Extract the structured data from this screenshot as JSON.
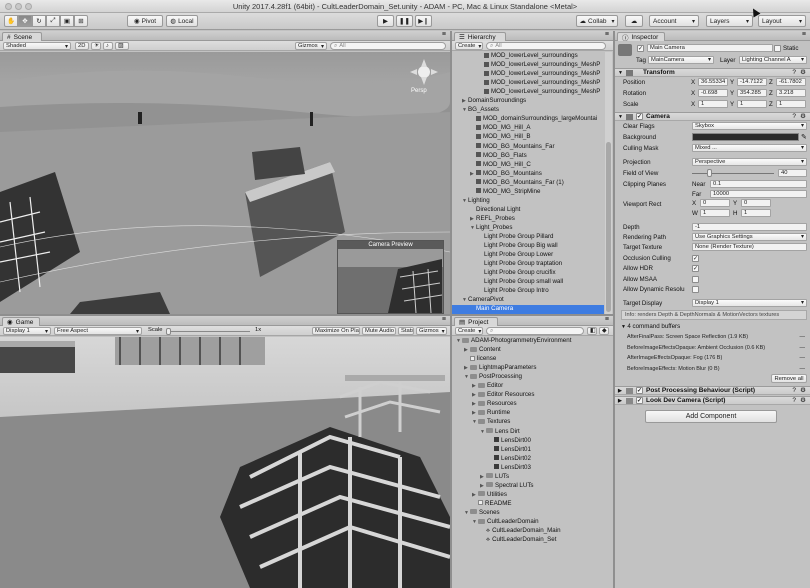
{
  "window": {
    "title": "Unity 2017.4.28f1 (64bit) - CultLeaderDomain_Set.unity - ADAM - PC, Mac & Linux Standalone <Metal>"
  },
  "toolbar": {
    "pivot": "Pivot",
    "local": "Local",
    "collab": "Collab",
    "account": "Account",
    "layers": "Layers",
    "layout": "Layout"
  },
  "scene": {
    "tab": "Scene",
    "shading": "Shaded",
    "mode_2d": "2D",
    "gizmos": "Gizmos",
    "search": "All",
    "persp": "Persp",
    "camera_preview": "Camera Preview"
  },
  "game": {
    "tab": "Game",
    "display": "Display 1",
    "aspect": "Free Aspect",
    "scale_label": "Scale",
    "scale_value": "1x",
    "maximize": "Maximize On Play",
    "mute": "Mute Audio",
    "stats": "Stats",
    "gizmos": "Gizmos"
  },
  "hierarchy": {
    "tab": "Hierarchy",
    "create": "Create",
    "search": "All",
    "items": [
      {
        "indent": 3,
        "label": "MOD_lowerLevel_surroundings",
        "fold": "",
        "icon": "cube"
      },
      {
        "indent": 3,
        "label": "MOD_lowerLevel_surroundings_MeshP",
        "fold": "",
        "icon": "cube"
      },
      {
        "indent": 3,
        "label": "MOD_lowerLevel_surroundings_MeshP",
        "fold": "",
        "icon": "cube"
      },
      {
        "indent": 3,
        "label": "MOD_lowerLevel_surroundings_MeshP",
        "fold": "",
        "icon": "cube"
      },
      {
        "indent": 3,
        "label": "MOD_lowerLevel_surroundings_MeshP",
        "fold": "",
        "icon": "cube"
      },
      {
        "indent": 1,
        "label": "DomainSurroundings",
        "fold": "▶",
        "icon": ""
      },
      {
        "indent": 1,
        "label": "BG_Assets",
        "fold": "▼",
        "icon": ""
      },
      {
        "indent": 2,
        "label": "MOD_domainSurroundings_largeMountai",
        "fold": "",
        "icon": "cube"
      },
      {
        "indent": 2,
        "label": "MOD_MG_Hill_A",
        "fold": "",
        "icon": "cube"
      },
      {
        "indent": 2,
        "label": "MOD_MG_Hill_B",
        "fold": "",
        "icon": "cube"
      },
      {
        "indent": 2,
        "label": "MOD_BG_Mountains_Far",
        "fold": "",
        "icon": "cube"
      },
      {
        "indent": 2,
        "label": "MOD_BG_Flats",
        "fold": "",
        "icon": "cube"
      },
      {
        "indent": 2,
        "label": "MOD_MG_Hill_C",
        "fold": "",
        "icon": "cube"
      },
      {
        "indent": 2,
        "label": "MOD_BG_Mountains",
        "fold": "▶",
        "icon": "cube"
      },
      {
        "indent": 2,
        "label": "MOD_BG_Mountains_Far (1)",
        "fold": "",
        "icon": "cube"
      },
      {
        "indent": 2,
        "label": "MOD_MG_StripMine",
        "fold": "",
        "icon": "cube"
      },
      {
        "indent": 1,
        "label": "Lighting",
        "fold": "▼",
        "icon": ""
      },
      {
        "indent": 2,
        "label": "Directional Light",
        "fold": "",
        "icon": ""
      },
      {
        "indent": 2,
        "label": "REFL_Probes",
        "fold": "▶",
        "icon": ""
      },
      {
        "indent": 2,
        "label": "Light_Probes",
        "fold": "▼",
        "icon": ""
      },
      {
        "indent": 3,
        "label": "Light Probe Group Pillard",
        "fold": "",
        "icon": ""
      },
      {
        "indent": 3,
        "label": "Light Probe Group Big wall",
        "fold": "",
        "icon": ""
      },
      {
        "indent": 3,
        "label": "Light Probe Group Lower",
        "fold": "",
        "icon": ""
      },
      {
        "indent": 3,
        "label": "Light Probe Group traptation",
        "fold": "",
        "icon": ""
      },
      {
        "indent": 3,
        "label": "Light Probe Group crucifix",
        "fold": "",
        "icon": ""
      },
      {
        "indent": 3,
        "label": "Light Probe Group small wall",
        "fold": "",
        "icon": ""
      },
      {
        "indent": 3,
        "label": "Light Probe Group Intro",
        "fold": "",
        "icon": ""
      },
      {
        "indent": 1,
        "label": "CameraPivot",
        "fold": "▼",
        "icon": ""
      },
      {
        "indent": 2,
        "label": "Main Camera",
        "fold": "",
        "icon": "",
        "selected": true
      }
    ]
  },
  "project": {
    "tab": "Project",
    "create": "Create",
    "items": [
      {
        "indent": 0,
        "label": "ADAM-PhotogrammetryEnvironment",
        "fold": "▼",
        "icon": "folder"
      },
      {
        "indent": 1,
        "label": "Content",
        "fold": "▶",
        "icon": "folder"
      },
      {
        "indent": 1,
        "label": "license",
        "fold": "",
        "icon": "file"
      },
      {
        "indent": 1,
        "label": "LightmapParameters",
        "fold": "▶",
        "icon": "folder"
      },
      {
        "indent": 1,
        "label": "PostProcessing",
        "fold": "▼",
        "icon": "folder"
      },
      {
        "indent": 2,
        "label": "Editor",
        "fold": "▶",
        "icon": "folder"
      },
      {
        "indent": 2,
        "label": "Editor Resources",
        "fold": "▶",
        "icon": "folder"
      },
      {
        "indent": 2,
        "label": "Resources",
        "fold": "▶",
        "icon": "folder"
      },
      {
        "indent": 2,
        "label": "Runtime",
        "fold": "▶",
        "icon": "folder"
      },
      {
        "indent": 2,
        "label": "Textures",
        "fold": "▼",
        "icon": "folder"
      },
      {
        "indent": 3,
        "label": "Lens Dirt",
        "fold": "▼",
        "icon": "folder"
      },
      {
        "indent": 4,
        "label": "LensDirt00",
        "fold": "",
        "icon": "tex"
      },
      {
        "indent": 4,
        "label": "LensDirt01",
        "fold": "",
        "icon": "tex"
      },
      {
        "indent": 4,
        "label": "LensDirt02",
        "fold": "",
        "icon": "tex"
      },
      {
        "indent": 4,
        "label": "LensDirt03",
        "fold": "",
        "icon": "tex"
      },
      {
        "indent": 3,
        "label": "LUTs",
        "fold": "▶",
        "icon": "folder"
      },
      {
        "indent": 3,
        "label": "Spectral LUTs",
        "fold": "▶",
        "icon": "folder"
      },
      {
        "indent": 2,
        "label": "Utilities",
        "fold": "▶",
        "icon": "folder"
      },
      {
        "indent": 2,
        "label": "README",
        "fold": "",
        "icon": "file"
      },
      {
        "indent": 1,
        "label": "Scenes",
        "fold": "▼",
        "icon": "folder"
      },
      {
        "indent": 2,
        "label": "CultLeaderDomain",
        "fold": "▼",
        "icon": "folder"
      },
      {
        "indent": 3,
        "label": "CultLeaderDomain_Main",
        "fold": "",
        "icon": "scene"
      },
      {
        "indent": 3,
        "label": "CultLeaderDomain_Set",
        "fold": "",
        "icon": "scene"
      }
    ]
  },
  "inspector": {
    "tab": "Inspector",
    "object_name": "Main Camera",
    "static": "Static",
    "tag_label": "Tag",
    "tag_value": "MainCamera",
    "layer_label": "Layer",
    "layer_value": "Lighting Channel A",
    "transform": {
      "title": "Transform",
      "position": "Position",
      "rotation": "Rotation",
      "scale": "Scale",
      "pos": [
        "36.55334",
        "-14.7122",
        "-61.7802"
      ],
      "rot": [
        "-0.698",
        "354.285",
        "3.218"
      ],
      "scl": [
        "1",
        "1",
        "1"
      ]
    },
    "camera": {
      "title": "Camera",
      "clear_flags": "Clear Flags",
      "clear_flags_value": "Skybox",
      "background": "Background",
      "culling_mask": "Culling Mask",
      "culling_mask_value": "Mixed ...",
      "projection": "Projection",
      "projection_value": "Perspective",
      "fov": "Field of View",
      "fov_value": "40",
      "clipping": "Clipping Planes",
      "near": "Near",
      "near_value": "0.1",
      "far": "Far",
      "far_value": "10000",
      "viewport": "Viewport Rect",
      "vx": "0",
      "vy": "0",
      "vw": "1",
      "vh": "1",
      "depth": "Depth",
      "depth_value": "-1",
      "rendering_path": "Rendering Path",
      "rendering_path_value": "Use Graphics Settings",
      "target_texture": "Target Texture",
      "target_texture_value": "None (Render Texture)",
      "occlusion": "Occlusion Culling",
      "hdr": "Allow HDR",
      "msaa": "Allow MSAA",
      "dynres": "Allow Dynamic Resolu",
      "target_display": "Target Display",
      "target_display_value": "Display 1",
      "info": "Info: renders Depth & DepthNormals & MotionVectors textures"
    },
    "command_buffers": {
      "title": "4 command buffers",
      "items": [
        {
          "event": "AfterFinalPass: Screen Space Reflection (1.9 KB)"
        },
        {
          "event": "BeforeImageEffectsOpaque: Ambient Occlusion (0.6 KB)"
        },
        {
          "event": "AfterImageEffectsOpaque: Fog (176 B)"
        },
        {
          "event": "BeforeImageEffects: Motion Blur (0 B)"
        }
      ],
      "remove_all": "Remove all"
    },
    "components": [
      "Post Processing Behaviour (Script)",
      "Look Dev Camera (Script)"
    ],
    "add_component": "Add Component"
  }
}
